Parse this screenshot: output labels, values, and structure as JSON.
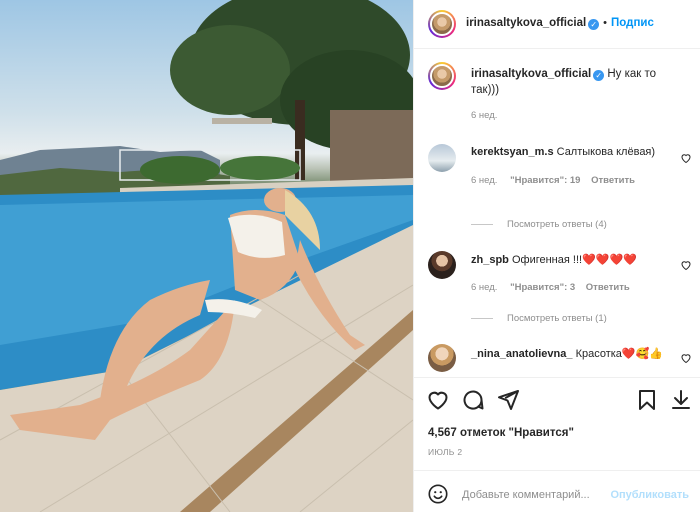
{
  "post": {
    "username": "irinasaltykova_official",
    "follow_label": "Подпис",
    "caption": "Ну как то так)))",
    "caption_time": "6 нед."
  },
  "comments": [
    {
      "user": "kerektsyan_m.s",
      "text": "Салтыкова клёвая)",
      "time": "6 нед.",
      "likes": "\"Нравится\": 19",
      "reply": "Ответить",
      "view_replies": "Посмотреть ответы (4)"
    },
    {
      "user": "zh_spb",
      "text": "Офигенная !!!❤️❤️❤️❤️",
      "time": "6 нед.",
      "likes": "\"Нравится\": 3",
      "reply": "Ответить",
      "view_replies": "Посмотреть ответы (1)"
    },
    {
      "user": "_nina_anatolievna_",
      "text": "Красотка❤️🥰👍"
    }
  ],
  "footer": {
    "likes_count": "4,567 отметок \"Нравится\"",
    "date": "ИЮЛЬ 2",
    "add_comment_placeholder": "Добавьте комментарий...",
    "publish_label": "Опубликовать"
  },
  "icons": {
    "like": "heart-icon",
    "comment": "comment-icon",
    "share": "paper-plane-icon",
    "save": "bookmark-icon",
    "emoji": "smiley-icon",
    "verified": "verified-badge-icon"
  },
  "colors": {
    "accent": "#0095f6",
    "verified": "#3897f0",
    "muted": "#8e8e8e",
    "heart_red": "#ed4956"
  }
}
